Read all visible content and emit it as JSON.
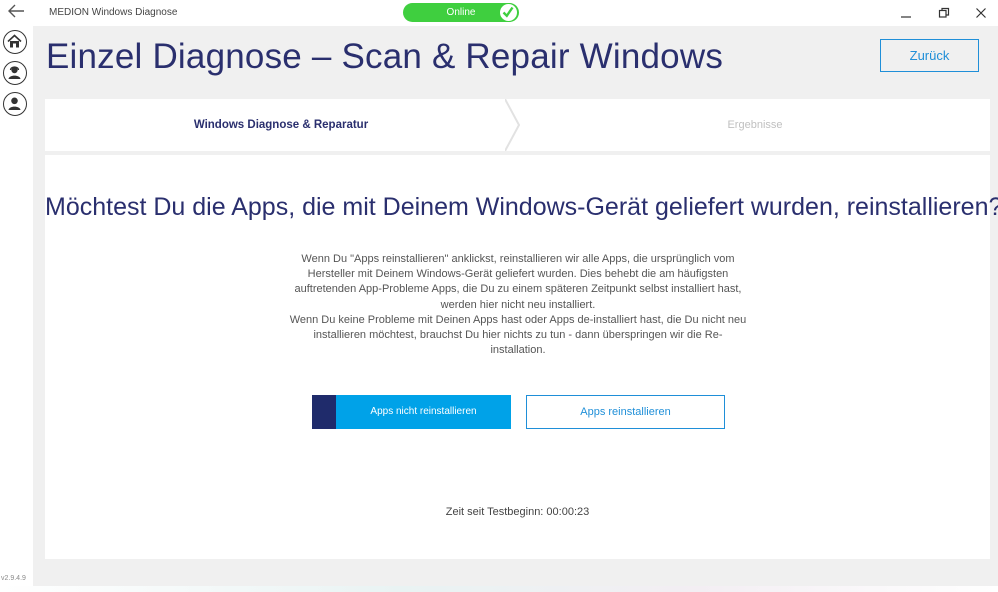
{
  "window": {
    "app_title": "MEDION Windows Diagnose",
    "status_label": "Online",
    "status_color": "#3fcf3f"
  },
  "rail": {
    "items": [
      {
        "icon": "home-icon"
      },
      {
        "icon": "user-support-icon"
      },
      {
        "icon": "user-icon"
      }
    ],
    "version": "v2.9.4.9"
  },
  "header": {
    "title": "Einzel Diagnose – Scan & Repair Windows",
    "back_label": "Zurück"
  },
  "steps": [
    {
      "label": "Windows Diagnose & Reparatur",
      "active": true
    },
    {
      "label": "Ergebnisse",
      "active": false
    }
  ],
  "main": {
    "question": "Möchtest Du die Apps, die mit Deinem Windows-Gerät geliefert wurden, reinstallieren?",
    "description_1": "Wenn Du \"Apps reinstallieren\" anklickst,  reinstallieren wir alle Apps, die ursprünglich vom Hersteller mit Deinem Windows-Gerät geliefert wurden. Dies behebt die am häufigsten auftretenden App-Probleme Apps, die Du zu einem späteren Zeitpunkt selbst installiert hast, werden hier nicht neu installiert.",
    "description_2": "Wenn Du keine Probleme mit Deinen Apps hast oder Apps de-installiert hast, die Du nicht neu installieren möchtest, brauchst Du hier nichts zu tun - dann überspringen wir die Re-installation.",
    "skip_label": "Apps nicht reinstallieren",
    "reinstall_label": "Apps reinstallieren",
    "timer_label": "Zeit seit Testbeginn: 00:00:23"
  },
  "colors": {
    "accent": "#1f8fd8",
    "primary_button": "#00a2e8",
    "primary_stripe": "#1f2b6b",
    "heading": "#2a2f6e"
  }
}
